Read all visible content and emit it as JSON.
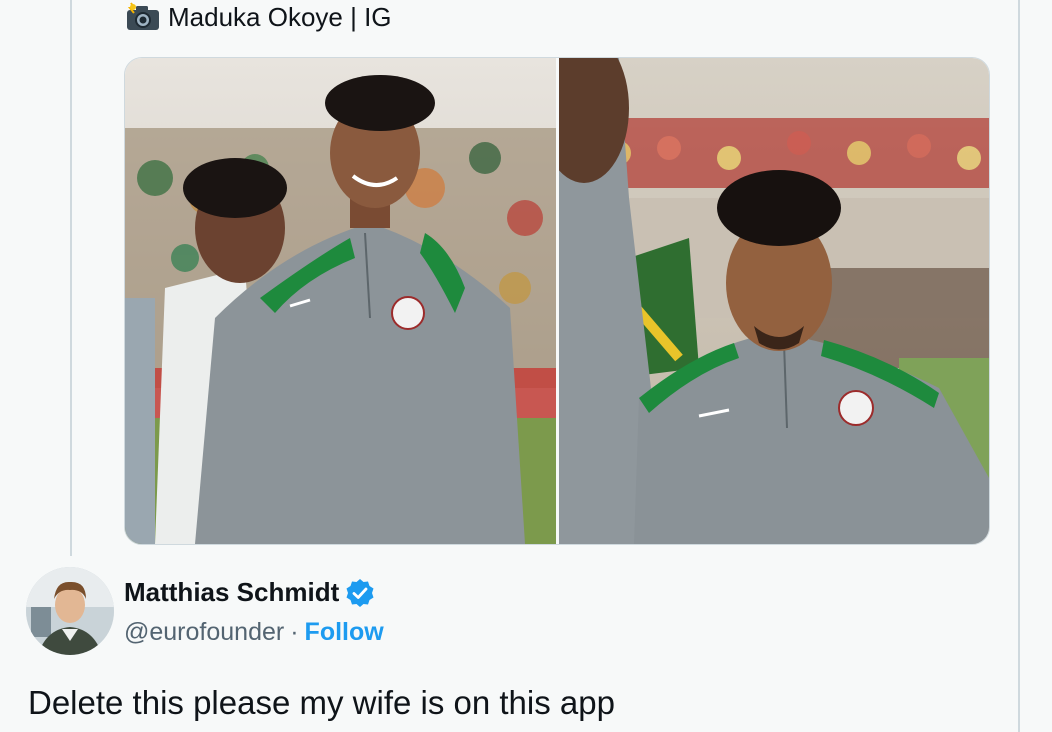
{
  "quoted": {
    "icon": "camera-flash-icon",
    "author_line": "Maduka Okoye | IG"
  },
  "media": {
    "photos": [
      "player-photo-left",
      "player-photo-right"
    ]
  },
  "tweet": {
    "author_name": "Matthias Schmidt",
    "verified_icon": "verified-badge-icon",
    "handle": "@eurofounder",
    "separator": "·",
    "follow_label": "Follow",
    "text": "Delete this please my wife is on this app"
  },
  "colors": {
    "accent": "#1d9bf0",
    "text": "#0f1419",
    "muted": "#536471",
    "background": "#f7f9f9"
  }
}
